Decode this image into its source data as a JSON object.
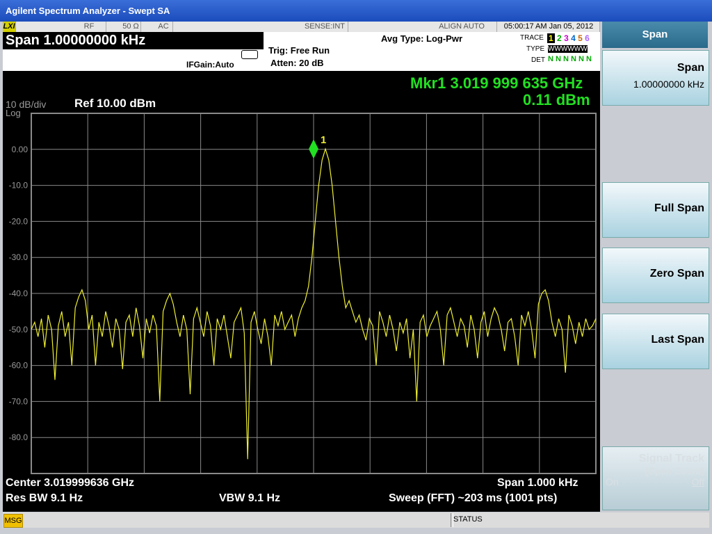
{
  "window_title": "Agilent Spectrum Analyzer - Swept SA",
  "status_row": {
    "lxi": "LXI",
    "rf": "RF",
    "impedance": "50 Ω",
    "coupling": "AC",
    "sense": "SENSE:INT",
    "align": "ALIGN AUTO",
    "time": "05:00:17 AM Jan 05, 2012"
  },
  "settings": {
    "span_label": "Span  1.00000000 kHz",
    "trig": "Trig: Free Run",
    "atten": "Atten: 20 dB",
    "ifgain": "IFGain:Auto",
    "avg_type": "Avg Type: Log-Pwr",
    "trace_label": "TRACE",
    "trace_nums": [
      "1",
      "2",
      "3",
      "4",
      "5",
      "6"
    ],
    "type_label": "TYPE",
    "type_val": "WWWWWW",
    "det_label": "DET",
    "det_val": "N N N N N N"
  },
  "display": {
    "scale": "10 dB/div",
    "scale_type": "Log",
    "ref": "Ref 10.00 dBm",
    "marker_freq": "Mkr1 3.019 999 635 GHz",
    "marker_amp": "0.11 dBm",
    "marker_id": "1",
    "y_ticks": [
      "0.00",
      "-10.0",
      "-20.0",
      "-30.0",
      "-40.0",
      "-50.0",
      "-60.0",
      "-70.0",
      "-80.0"
    ]
  },
  "footer": {
    "center": "Center 3.019999636 GHz",
    "res_bw": "Res BW 9.1 Hz",
    "vbw": "VBW 9.1 Hz",
    "span": "Span 1.000 kHz",
    "sweep": "Sweep (FFT)  ~203 ms (1001 pts)"
  },
  "softkeys": {
    "menu_title": "Span",
    "span_label": "Span",
    "span_value": "1.00000000 kHz",
    "full_span": "Full Span",
    "zero_span": "Zero Span",
    "last_span": "Last Span",
    "signal_track": "Signal Track",
    "signal_track_sub": "(Span Zoom)",
    "on": "On",
    "off": "Off"
  },
  "bottom": {
    "msg": "MSG",
    "status": "STATUS"
  },
  "colors": {
    "trace": "#f0f030",
    "marker": "#22e022",
    "grid": "#8a8a8a"
  },
  "chart_data": {
    "type": "line",
    "x_center_ghz": 3.019999636,
    "span_khz": 1.0,
    "ylim": [
      -90,
      10
    ],
    "y_ticks": [
      0,
      -10,
      -20,
      -30,
      -40,
      -50,
      -60,
      -70,
      -80
    ],
    "peak": {
      "x_offset_hz": 0,
      "y": 0.11
    },
    "series": [
      {
        "values": [
          -50,
          -48,
          -52,
          -47,
          -55,
          -46,
          -50,
          -64,
          -49,
          -45,
          -52,
          -48,
          -60,
          -44,
          -41,
          -39,
          -42,
          -50,
          -46,
          -60,
          -48,
          -52,
          -45,
          -49,
          -55,
          -47,
          -50,
          -61,
          -48,
          -46,
          -52,
          -44,
          -49,
          -58,
          -47,
          -51,
          -46,
          -49,
          -70,
          -45,
          -42,
          -40,
          -43,
          -48,
          -52,
          -46,
          -50,
          -68,
          -47,
          -44,
          -48,
          -52,
          -45,
          -49,
          -60,
          -47,
          -50,
          -46,
          -52,
          -58,
          -48,
          -46,
          -44,
          -51,
          -86,
          -48,
          -45,
          -50,
          -54,
          -47,
          -52,
          -60,
          -46,
          -49,
          -45,
          -50,
          -48,
          -46,
          -52,
          -47,
          -44,
          -42,
          -38,
          -30,
          -20,
          -10,
          -3,
          0.11,
          -3,
          -10,
          -20,
          -30,
          -38,
          -44,
          -42,
          -45,
          -48,
          -46,
          -50,
          -53,
          -47,
          -49,
          -60,
          -45,
          -48,
          -52,
          -46,
          -50,
          -56,
          -48,
          -51,
          -47,
          -58,
          -50,
          -70,
          -48,
          -46,
          -52,
          -49,
          -47,
          -45,
          -50,
          -60,
          -46,
          -44,
          -48,
          -52,
          -47,
          -49,
          -55,
          -46,
          -50,
          -58,
          -48,
          -45,
          -52,
          -47,
          -44,
          -46,
          -50,
          -56,
          -48,
          -47,
          -52,
          -60,
          -46,
          -49,
          -45,
          -50,
          -58,
          -43,
          -40,
          -39,
          -42,
          -48,
          -52,
          -47,
          -50,
          -62,
          -46,
          -49,
          -54,
          -48,
          -52,
          -47,
          -50,
          -49,
          -47
        ]
      }
    ]
  }
}
